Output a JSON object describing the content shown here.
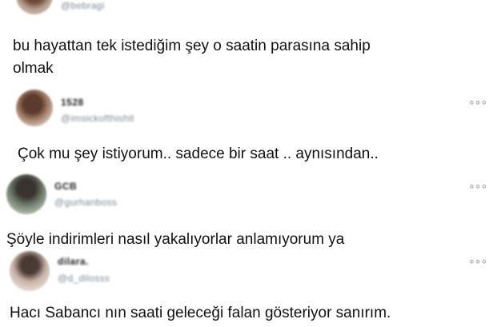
{
  "tweets": [
    {
      "name": "",
      "handle": "@bebragi",
      "text_lines": [
        "bu hayattan tek istediğim şey o saatin parasına sahip",
        "olmak"
      ],
      "more_icon": "ellipsis-icon"
    },
    {
      "name": "1528",
      "handle": "@imsickofthishit",
      "text_lines": [
        "Çok mu şey istiyorum.. sadece bir saat .. aynısından.."
      ],
      "more_icon": "ellipsis-icon"
    },
    {
      "name": "GCB",
      "handle": "@gurhanboss",
      "text_lines": [
        "Şöyle indirimleri nasıl yakalıyorlar anlamıyorum ya"
      ],
      "more_icon": "ellipsis-icon"
    },
    {
      "name": "dilara.",
      "handle": "@d_dilosss",
      "text_lines": [
        "Hacı Sabancı nın saati geleceği falan gösteriyor sanırım."
      ],
      "more_icon": "ellipsis-icon"
    }
  ],
  "more_glyph": "∘∘∘"
}
